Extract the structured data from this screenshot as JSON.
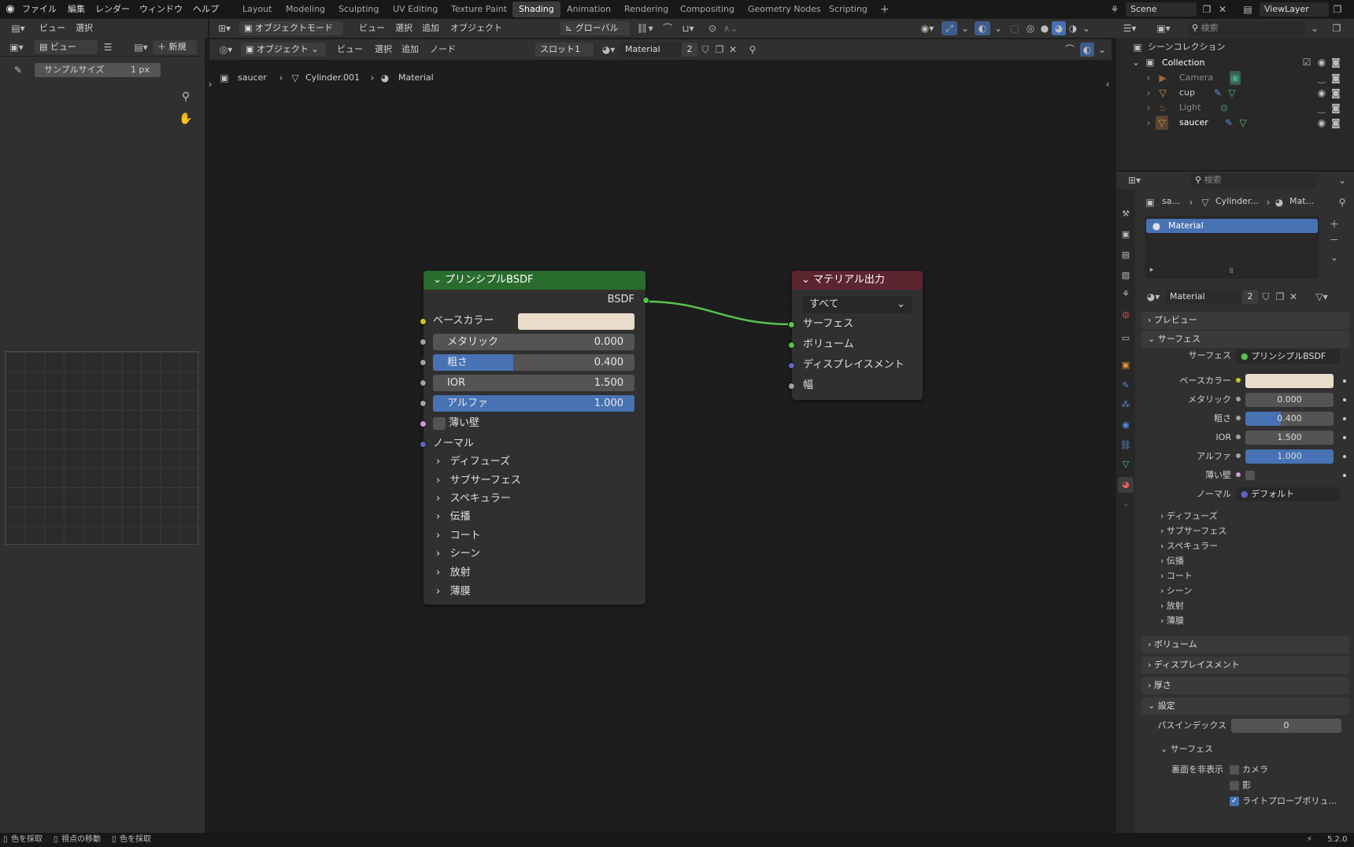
{
  "topbar": {
    "menus": [
      "ファイル",
      "編集",
      "レンダー",
      "ウィンドウ",
      "ヘルプ"
    ],
    "workspaces": [
      "Layout",
      "Modeling",
      "Sculpting",
      "UV Editing",
      "Texture Paint",
      "Shading",
      "Animation",
      "Rendering",
      "Compositing",
      "Geometry Nodes",
      "Scripting"
    ],
    "active_workspace": "Shading",
    "add_tab": "+",
    "scene": "Scene",
    "viewlayer": "ViewLayer"
  },
  "viewport_header": {
    "mode": "オブジェクトモード",
    "menus": [
      "ビュー",
      "選択",
      "追加",
      "オブジェクト"
    ],
    "orientation": "グローバル",
    "search_placeholder": "検索"
  },
  "image_editor": {
    "menus": [
      "ビュー",
      "選択"
    ],
    "view_label": "ビュー",
    "new_button": "新規",
    "sample_size_label": "サンプルサイズ",
    "sample_size_value": "1 px"
  },
  "node_header": {
    "object_menu": "オブジェクト",
    "menus": [
      "ビュー",
      "選択",
      "追加",
      "ノード"
    ],
    "slot": "スロット1",
    "material": "Material",
    "users": "2"
  },
  "breadcrumb": {
    "object": "saucer",
    "mesh": "Cylinder.001",
    "material": "Material"
  },
  "bsdf_node": {
    "title": "プリンシプルBSDF",
    "output": "BSDF",
    "base_color_label": "ベースカラー",
    "base_color": "#eadccb",
    "metallic_label": "メタリック",
    "metallic": "0.000",
    "metallic_frac": 0,
    "roughness_label": "粗さ",
    "roughness": "0.400",
    "roughness_frac": 0.4,
    "ior_label": "IOR",
    "ior": "1.500",
    "ior_frac": 0,
    "alpha_label": "アルファ",
    "alpha": "1.000",
    "alpha_frac": 1,
    "thin_wall_label": "薄い壁",
    "normal_label": "ノーマル",
    "subpanels": [
      "ディフューズ",
      "サブサーフェス",
      "スペキュラー",
      "伝播",
      "コート",
      "シーン",
      "放射",
      "薄膜"
    ]
  },
  "output_node": {
    "title": "マテリアル出力",
    "target": "すべて",
    "inputs": [
      "サーフェス",
      "ボリューム",
      "ディスプレイスメント",
      "幅"
    ]
  },
  "outliner": {
    "scene_collection": "シーンコレクション",
    "collection": "Collection",
    "items": [
      "Camera",
      "cup",
      "Light",
      "saucer"
    ]
  },
  "properties": {
    "search_placeholder": "検索",
    "breadcrumb": [
      "sa...",
      "Cylinder...",
      "Mat..."
    ],
    "slot_name": "Material",
    "material_name": "Material",
    "users": "2",
    "sections": {
      "preview": "プレビュー",
      "surface": "サーフェス",
      "volume": "ボリューム",
      "displacement": "ディスプレイスメント",
      "thickness": "厚さ",
      "settings": "設定"
    },
    "surface_label": "サーフェス",
    "surface_value": "プリンシプルBSDF",
    "base_color_label": "ベースカラー",
    "metallic_label": "メタリック",
    "metallic": "0.000",
    "roughness_label": "粗さ",
    "roughness": "0.400",
    "ior_label": "IOR",
    "ior": "1.500",
    "alpha_label": "アルファ",
    "alpha": "1.000",
    "thin_wall_label": "薄い壁",
    "normal_label": "ノーマル",
    "normal_value": "デフォルト",
    "subpanels": [
      "ディフューズ",
      "サブサーフェス",
      "スペキュラー",
      "伝播",
      "コート",
      "シーン",
      "放射",
      "薄膜"
    ],
    "pass_index_label": "パスインデックス",
    "pass_index": "0",
    "settings_surface": "サーフェス",
    "backface_label": "裏面を非表示",
    "camera_label": "カメラ",
    "shadow_label": "影",
    "lightprobe_label": "ライトプローブボリュ..."
  },
  "statusbar": {
    "items": [
      "色を採取",
      "視点の移動",
      "色を採取"
    ],
    "version": "5.2.0"
  },
  "colors": {
    "accent": "#4772b3",
    "shader_head": "#2a6b2e",
    "output_head": "#5c2530",
    "link": "#58c250"
  }
}
